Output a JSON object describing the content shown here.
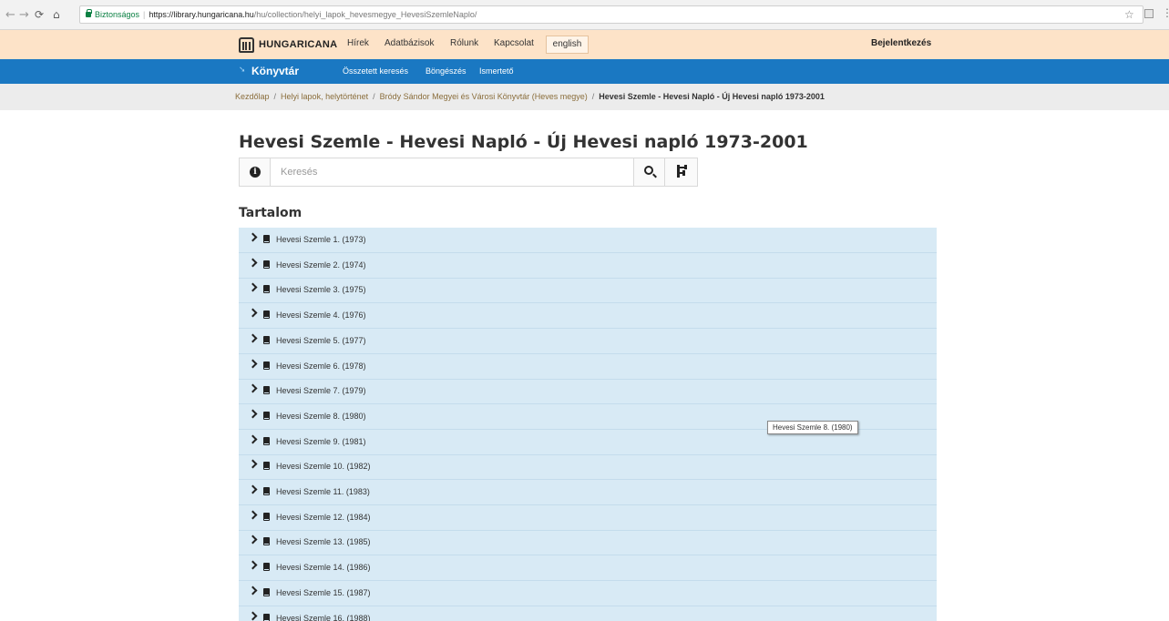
{
  "browser": {
    "secure_label": "Biztonságos",
    "url_host": "https://library.hungaricana.hu",
    "url_path": "/hu/collection/helyi_lapok_hevesmegye_HevesiSzemleNaplo/",
    "back_icon": "arrow-left",
    "forward_icon": "arrow-right",
    "reload_icon": "reload",
    "home_icon": "home",
    "bookmark_icon": "star",
    "menu_icon": "vertical-dots"
  },
  "header": {
    "logo_text": "HUNGARICANA",
    "nav": [
      "Hírek",
      "Adatbázisok",
      "Rólunk",
      "Kapcsolat"
    ],
    "language": "english",
    "login": "Bejelentkezés",
    "background_color": "#fde3c8"
  },
  "module": {
    "title": "Könyvtár",
    "links": [
      "Összetett keresés",
      "Böngészés",
      "Ismertető"
    ],
    "color": "#1a78c2"
  },
  "breadcrumb": {
    "items": [
      "Kezdőlap",
      "Helyi lapok, helytörténet",
      "Bródy Sándor Megyei és Városi Könyvtár (Heves megye)"
    ],
    "current": "Hevesi Szemle - Hevesi Napló - Új Hevesi napló 1973-2001",
    "separator": "/"
  },
  "main": {
    "title": "Hevesi Szemle - Hevesi Napló - Új Hevesi napló 1973-2001",
    "search_placeholder": "Keresés",
    "section_title": "Tartalom",
    "toc": [
      "Hevesi Szemle 1. (1973)",
      "Hevesi Szemle 2. (1974)",
      "Hevesi Szemle 3. (1975)",
      "Hevesi Szemle 4. (1976)",
      "Hevesi Szemle 5. (1977)",
      "Hevesi Szemle 6. (1978)",
      "Hevesi Szemle 7. (1979)",
      "Hevesi Szemle 8. (1980)",
      "Hevesi Szemle 9. (1981)",
      "Hevesi Szemle 10. (1982)",
      "Hevesi Szemle 11. (1983)",
      "Hevesi Szemle 12. (1984)",
      "Hevesi Szemle 13. (1985)",
      "Hevesi Szemle 14. (1986)",
      "Hevesi Szemle 15. (1987)",
      "Hevesi Szemle 16. (1988)"
    ],
    "tooltip": "Hevesi Szemle 8. (1980)",
    "toc_background": "#d8eaf5"
  }
}
